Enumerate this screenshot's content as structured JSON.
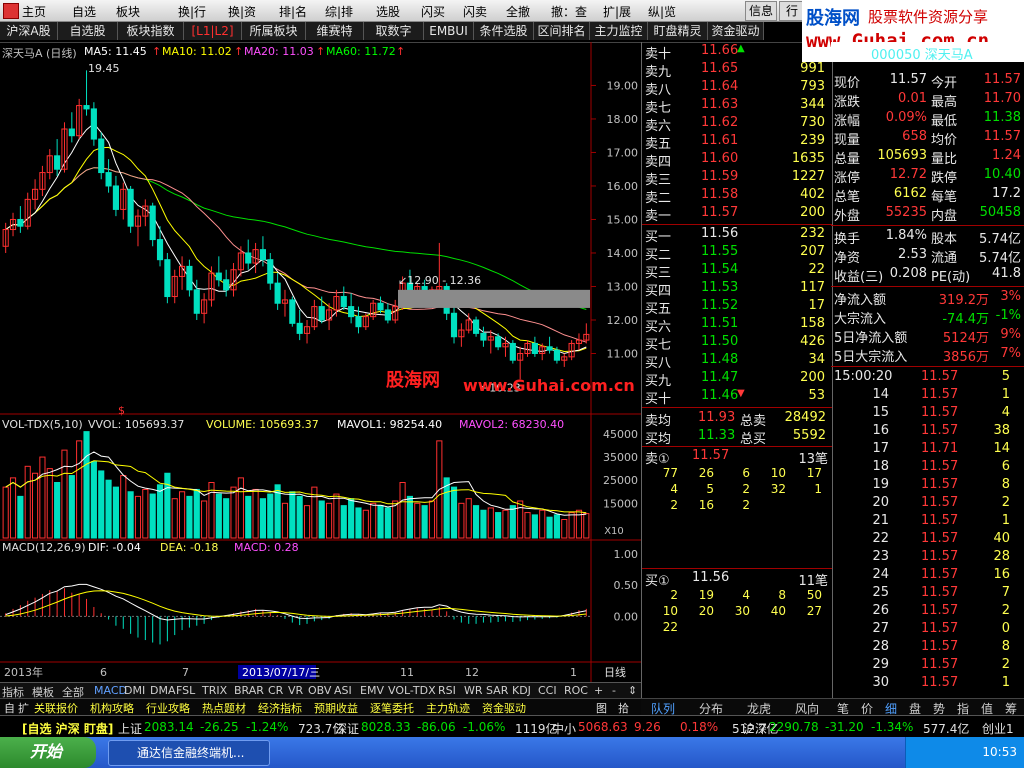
{
  "menu": {
    "items": [
      "主页",
      "自选",
      "板块",
      "换|行",
      "换|资",
      "排|名",
      "综|排",
      "选股",
      "闪买",
      "闪卖",
      "全撤",
      "撤：查",
      "扩|展",
      "纵|览"
    ],
    "info_button": "信息",
    "row_button": "行"
  },
  "brand": {
    "name": "股海网",
    "tagline": "股票软件资源分享",
    "url": "www.Guhai.com.cn"
  },
  "toolbar": [
    "沪深A股",
    "自选股",
    "板块指数",
    "[L1|L2]",
    "所属板块",
    "维赛特",
    "取数字",
    "EMBUI",
    "条件选股",
    "区间排名",
    "主力监控",
    "盯盘精灵",
    "资金驱动"
  ],
  "toolbar_selected": 3,
  "chart": {
    "title": "深天马A (日线)",
    "ma": [
      {
        "label": "MA5: 11.45",
        "color": "#ffffff"
      },
      {
        "label": "MA10: 11.02",
        "color": "#ffff00"
      },
      {
        "label": "MA20: 11.03",
        "color": "#ff50ff"
      },
      {
        "label": "MA60: 11.72",
        "color": "#00ff00"
      }
    ],
    "price_ticks": [
      "19.00",
      "18.00",
      "17.00",
      "16.00",
      "15.00",
      "14.00",
      "13.00",
      "12.00",
      "11.00"
    ],
    "high_marker": "19.45",
    "low_marker": "10.23",
    "range_label": "12.90 - 12.36",
    "watermark1": "股海网",
    "watermark2": "www.Guhai.com.cn",
    "vol_header": {
      "name": "VOL-TDX(5,10)",
      "vvol": "VVOL: 105693.37",
      "volume": "VOLUME: 105693.37",
      "mavol1": "MAVOL1: 98254.40",
      "mavol2": "MAVOL2: 68230.40"
    },
    "vol_ticks": [
      "45000",
      "35000",
      "25000",
      "15000"
    ],
    "vol_unit": "X10",
    "macd_header": {
      "name": "MACD(12,26,9)",
      "dif": "DIF: -0.04",
      "dea": "DEA: -0.18",
      "macd": "MACD: 0.28"
    },
    "macd_ticks": [
      "1.00",
      "0.50",
      "0.00"
    ],
    "date_axis": [
      "2013年",
      "6",
      "7",
      "2013/07/17/三",
      "11",
      "12",
      "1"
    ],
    "period": "日线"
  },
  "chart_data": {
    "type": "candlestick",
    "price_range": [
      10.0,
      19.7
    ],
    "bars": [
      [
        14.2,
        14.9,
        14.0,
        14.7
      ],
      [
        14.7,
        15.2,
        14.5,
        15.0
      ],
      [
        15.0,
        15.4,
        14.6,
        14.8
      ],
      [
        14.8,
        15.8,
        14.7,
        15.6
      ],
      [
        15.6,
        16.2,
        15.3,
        15.9
      ],
      [
        15.9,
        16.6,
        15.7,
        16.4
      ],
      [
        16.4,
        17.1,
        16.2,
        16.9
      ],
      [
        16.9,
        17.4,
        16.3,
        16.5
      ],
      [
        16.5,
        17.9,
        16.4,
        17.7
      ],
      [
        17.7,
        18.2,
        17.3,
        17.5
      ],
      [
        17.5,
        18.6,
        17.4,
        18.4
      ],
      [
        18.4,
        19.45,
        18.1,
        18.3
      ],
      [
        18.3,
        18.5,
        17.2,
        17.4
      ],
      [
        17.4,
        17.6,
        16.2,
        16.4
      ],
      [
        16.4,
        16.8,
        15.8,
        16.0
      ],
      [
        16.0,
        16.3,
        15.1,
        15.3
      ],
      [
        15.3,
        16.1,
        15.0,
        15.9
      ],
      [
        15.9,
        16.0,
        14.6,
        14.8
      ],
      [
        14.8,
        15.3,
        14.2,
        15.1
      ],
      [
        15.1,
        15.6,
        14.8,
        15.4
      ],
      [
        15.4,
        15.5,
        14.2,
        14.4
      ],
      [
        14.4,
        14.8,
        13.6,
        13.8
      ],
      [
        13.8,
        14.0,
        12.5,
        12.7
      ],
      [
        12.7,
        13.5,
        12.5,
        13.3
      ],
      [
        13.3,
        13.9,
        12.9,
        13.6
      ],
      [
        13.6,
        13.8,
        12.7,
        12.9
      ],
      [
        12.9,
        13.2,
        12.0,
        12.2
      ],
      [
        12.2,
        12.8,
        11.9,
        12.6
      ],
      [
        12.6,
        13.6,
        12.4,
        13.4
      ],
      [
        13.4,
        13.9,
        13.0,
        13.2
      ],
      [
        13.2,
        13.5,
        12.7,
        12.9
      ],
      [
        12.9,
        13.7,
        12.7,
        13.5
      ],
      [
        13.5,
        14.2,
        13.3,
        14.0
      ],
      [
        14.0,
        14.4,
        13.5,
        13.7
      ],
      [
        13.7,
        14.3,
        13.4,
        14.1
      ],
      [
        14.1,
        14.5,
        13.6,
        13.8
      ],
      [
        13.8,
        14.0,
        12.9,
        13.1
      ],
      [
        13.1,
        13.4,
        12.3,
        12.5
      ],
      [
        12.5,
        12.9,
        12.1,
        12.6
      ],
      [
        12.6,
        12.7,
        11.8,
        11.9
      ],
      [
        11.9,
        12.3,
        11.4,
        11.6
      ],
      [
        11.6,
        12.0,
        11.3,
        11.8
      ],
      [
        11.8,
        12.6,
        11.7,
        12.4
      ],
      [
        12.4,
        12.7,
        11.9,
        12.0
      ],
      [
        12.0,
        12.5,
        11.7,
        12.3
      ],
      [
        12.3,
        12.9,
        12.1,
        12.7
      ],
      [
        12.7,
        13.0,
        12.3,
        12.4
      ],
      [
        12.4,
        12.8,
        11.9,
        12.1
      ],
      [
        12.1,
        12.4,
        11.6,
        11.8
      ],
      [
        11.8,
        12.2,
        11.7,
        12.1
      ],
      [
        12.1,
        12.6,
        12.0,
        12.5
      ],
      [
        12.5,
        12.7,
        12.2,
        12.3
      ],
      [
        12.3,
        12.5,
        11.9,
        12.0
      ],
      [
        12.0,
        12.6,
        11.9,
        12.4
      ],
      [
        12.4,
        13.3,
        12.3,
        13.1
      ],
      [
        13.1,
        13.5,
        12.7,
        12.8
      ],
      [
        12.8,
        13.1,
        12.5,
        13.0
      ],
      [
        13.0,
        13.2,
        12.6,
        12.7
      ],
      [
        12.7,
        13.0,
        12.4,
        12.9
      ],
      [
        12.9,
        14.3,
        12.8,
        13.0
      ],
      [
        13.0,
        13.1,
        12.0,
        12.2
      ],
      [
        12.2,
        12.5,
        11.3,
        11.5
      ],
      [
        11.5,
        11.9,
        11.2,
        11.7
      ],
      [
        11.7,
        12.2,
        11.6,
        12.0
      ],
      [
        12.0,
        12.1,
        11.5,
        11.6
      ],
      [
        11.6,
        11.8,
        11.2,
        11.4
      ],
      [
        11.4,
        11.7,
        11.0,
        11.5
      ],
      [
        11.5,
        11.6,
        11.1,
        11.2
      ],
      [
        11.2,
        11.5,
        10.9,
        11.3
      ],
      [
        11.3,
        11.4,
        10.7,
        10.8
      ],
      [
        10.8,
        11.2,
        10.23,
        11.0
      ],
      [
        11.0,
        11.4,
        10.9,
        11.3
      ],
      [
        11.3,
        11.5,
        10.9,
        11.0
      ],
      [
        11.0,
        11.3,
        10.8,
        11.2
      ],
      [
        11.2,
        11.5,
        11.0,
        11.1
      ],
      [
        11.1,
        11.2,
        10.7,
        10.8
      ],
      [
        10.8,
        11.0,
        10.6,
        10.9
      ],
      [
        10.9,
        11.4,
        10.8,
        11.3
      ],
      [
        11.3,
        11.6,
        11.1,
        11.4
      ],
      [
        11.4,
        11.9,
        11.3,
        11.57
      ]
    ],
    "volume_range": [
      0,
      48000
    ],
    "volumes": [
      22000,
      26000,
      18000,
      31000,
      28000,
      35000,
      30000,
      24000,
      38000,
      27000,
      42000,
      46000,
      33000,
      29000,
      25000,
      22000,
      27000,
      20000,
      18000,
      21000,
      19000,
      23000,
      28000,
      17000,
      20000,
      18000,
      21000,
      16000,
      24000,
      19000,
      17000,
      22000,
      26000,
      18000,
      21000,
      17000,
      19000,
      23000,
      15000,
      20000,
      18000,
      14000,
      22000,
      16000,
      15000,
      19000,
      14000,
      17000,
      13000,
      12000,
      15000,
      14000,
      13000,
      16000,
      24000,
      18000,
      15000,
      14000,
      16000,
      42000,
      26000,
      22000,
      15000,
      17000,
      14000,
      12000,
      13000,
      11000,
      12000,
      14000,
      16000,
      11000,
      10000,
      12000,
      9000,
      10000,
      8000,
      11000,
      12000,
      10569
    ],
    "macd_range": [
      -0.7,
      1.0
    ],
    "macd_hist": [
      0.05,
      0.12,
      0.18,
      0.25,
      0.3,
      0.36,
      0.42,
      0.4,
      0.45,
      0.38,
      0.35,
      0.28,
      0.15,
      0.05,
      -0.05,
      -0.15,
      -0.2,
      -0.28,
      -0.34,
      -0.38,
      -0.42,
      -0.45,
      -0.4,
      -0.3,
      -0.22,
      -0.18,
      -0.15,
      -0.12,
      -0.06,
      -0.02,
      0.02,
      0.05,
      0.08,
      0.1,
      0.12,
      0.1,
      0.06,
      0.02,
      -0.04,
      -0.1,
      -0.14,
      -0.12,
      -0.08,
      -0.06,
      -0.04,
      0.02,
      0.04,
      0.05,
      0.04,
      0.02,
      0.04,
      0.06,
      0.05,
      0.06,
      0.1,
      0.12,
      0.13,
      0.12,
      0.1,
      0.15,
      0.08,
      -0.05,
      -0.1,
      -0.12,
      -0.12,
      -0.1,
      -0.1,
      -0.09,
      -0.08,
      -0.09,
      -0.08,
      -0.06,
      -0.05,
      -0.04,
      -0.03,
      -0.02,
      0.02,
      0.06,
      0.1,
      0.12
    ]
  },
  "orderbook": {
    "sells": [
      {
        "name": "卖十",
        "price": "11.66",
        "vol": "",
        "flag": "▲"
      },
      {
        "name": "卖九",
        "price": "11.65",
        "vol": "991"
      },
      {
        "name": "卖八",
        "price": "11.64",
        "vol": "793"
      },
      {
        "name": "卖七",
        "price": "11.63",
        "vol": "344"
      },
      {
        "name": "卖六",
        "price": "11.62",
        "vol": "730"
      },
      {
        "name": "卖五",
        "price": "11.61",
        "vol": "239"
      },
      {
        "name": "卖四",
        "price": "11.60",
        "vol": "1635"
      },
      {
        "name": "卖三",
        "price": "11.59",
        "vol": "1227"
      },
      {
        "name": "卖二",
        "price": "11.58",
        "vol": "402"
      },
      {
        "name": "卖一",
        "price": "11.57",
        "vol": "200"
      }
    ],
    "buys": [
      {
        "name": "买一",
        "price": "11.56",
        "vol": "232"
      },
      {
        "name": "买二",
        "price": "11.55",
        "vol": "207"
      },
      {
        "name": "买三",
        "price": "11.54",
        "vol": "22"
      },
      {
        "name": "买四",
        "price": "11.53",
        "vol": "117"
      },
      {
        "name": "买五",
        "price": "11.52",
        "vol": "17"
      },
      {
        "name": "买六",
        "price": "11.51",
        "vol": "158"
      },
      {
        "name": "买七",
        "price": "11.50",
        "vol": "426"
      },
      {
        "name": "买八",
        "price": "11.48",
        "vol": "34"
      },
      {
        "name": "买九",
        "price": "11.47",
        "vol": "200"
      },
      {
        "name": "买十",
        "price": "11.46",
        "vol": "53",
        "flag": "▼"
      }
    ],
    "avg_sell_label": "卖均",
    "avg_sell": "11.93",
    "total_sell_label": "总卖",
    "total_sell": "28492",
    "avg_buy_label": "买均",
    "avg_buy": "11.33",
    "total_buy_label": "总买",
    "total_buy": "5592",
    "sell1_queue": {
      "label": "卖①",
      "price": "11.57",
      "count": "13笔",
      "rows": [
        [
          "77",
          "26",
          "6",
          "10",
          "17"
        ],
        [
          "4",
          "5",
          "2",
          "32",
          "1"
        ],
        [
          "2",
          "16",
          "2",
          "",
          ""
        ]
      ]
    },
    "buy1_queue": {
      "label": "买①",
      "price": "11.56",
      "count": "11笔",
      "rows": [
        [
          "2",
          "19",
          "4",
          "8",
          "50"
        ],
        [
          "10",
          "20",
          "30",
          "40",
          "27"
        ],
        [
          "22",
          "",
          "",
          "",
          ""
        ]
      ]
    }
  },
  "quote": {
    "code_name": "000050 深天马A",
    "rows": [
      [
        "现价",
        "11.57",
        "今开",
        "11.57"
      ],
      [
        "涨跌",
        "0.01",
        "最高",
        "11.70"
      ],
      [
        "涨幅",
        "0.09%",
        "最低",
        "11.38"
      ],
      [
        "现量",
        "658",
        "均价",
        "11.57"
      ],
      [
        "总量",
        "105693",
        "量比",
        "1.24"
      ],
      [
        "涨停",
        "12.72",
        "跌停",
        "10.40"
      ],
      [
        "总笔",
        "6162",
        "每笔",
        "17.2"
      ],
      [
        "外盘",
        "55235",
        "内盘",
        "50458"
      ]
    ],
    "rows2": [
      [
        "换手",
        "1.84%",
        "股本",
        "5.74亿"
      ],
      [
        "净资",
        "2.53",
        "流通",
        "5.74亿"
      ],
      [
        "收益(三)",
        "0.208",
        "PE(动)",
        "41.8"
      ]
    ],
    "flows": [
      [
        "净流入额",
        "319.2万",
        "3%"
      ],
      [
        "大宗流入",
        "-74.4万",
        "-1%"
      ],
      [
        "5日净流入额",
        "5124万",
        "9%"
      ],
      [
        "5日大宗流入",
        "3856万",
        "7%"
      ]
    ],
    "ticks_header": {
      "time": "15:00:20",
      "price": "11.57",
      "vol": "5"
    },
    "ticks": [
      [
        "14",
        "11.57",
        "1"
      ],
      [
        "15",
        "11.57",
        "4"
      ],
      [
        "16",
        "11.57",
        "38"
      ],
      [
        "17",
        "11.71",
        "14"
      ],
      [
        "18",
        "11.57",
        "6"
      ],
      [
        "19",
        "11.57",
        "8"
      ],
      [
        "20",
        "11.57",
        "2"
      ],
      [
        "21",
        "11.57",
        "1"
      ],
      [
        "22",
        "11.57",
        "40"
      ],
      [
        "23",
        "11.57",
        "28"
      ],
      [
        "24",
        "11.57",
        "16"
      ],
      [
        "25",
        "11.57",
        "7"
      ],
      [
        "26",
        "11.57",
        "2"
      ],
      [
        "27",
        "11.57",
        "0"
      ],
      [
        "28",
        "11.57",
        "8"
      ],
      [
        "29",
        "11.57",
        "2"
      ],
      [
        "30",
        "11.57",
        "1"
      ]
    ]
  },
  "indicator_tabs": [
    "指标",
    "模板",
    "全部",
    "MACD",
    "DMI",
    "DMA",
    "FSL",
    "TRIX",
    "BRAR",
    "CR",
    "VR",
    "OBV",
    "ASI",
    "EMV",
    "VOL-TDX",
    "RSI",
    "WR",
    "SAR",
    "KDJ",
    "CCI",
    "ROC"
  ],
  "indicator_selected": "MACD",
  "bottom_tabs": [
    "自",
    "扩",
    "关联报价",
    "机构攻略",
    "行业攻略",
    "热点题材",
    "经济指标",
    "预期收益",
    "逐笔委托",
    "主力轨迹",
    "资金驱动"
  ],
  "bottom_right_tabs": [
    "图",
    "拾"
  ],
  "mid_tabs": [
    "队列",
    "分布",
    "龙虎",
    "风向"
  ],
  "right_tabs": [
    "笔",
    "价",
    "细",
    "盘",
    "势",
    "指",
    "值",
    "筹"
  ],
  "ticker": {
    "label": "[自选 沪深 盯盘]",
    "items": [
      {
        "name": "上证",
        "val": "2083.14",
        "chg": "-26.25",
        "pct": "-1.24%",
        "amt": "723.7亿"
      },
      {
        "name": "深证",
        "val": "8028.33",
        "chg": "-86.06",
        "pct": "-1.06%",
        "amt": "1119亿"
      },
      {
        "name": "中小",
        "val": "5068.63",
        "chg": "9.26",
        "pct": "0.18%",
        "amt": "512.7亿"
      },
      {
        "name": "沪深",
        "val": "2290.78",
        "chg": "-31.20",
        "pct": "-1.34%",
        "amt": "577.4亿"
      },
      {
        "name": "创业1",
        "val": "",
        "chg": "",
        "pct": "",
        "amt": ""
      }
    ]
  },
  "taskbar": {
    "start": "开始",
    "task": "通达信金融终端机...",
    "clock": "10:53"
  }
}
